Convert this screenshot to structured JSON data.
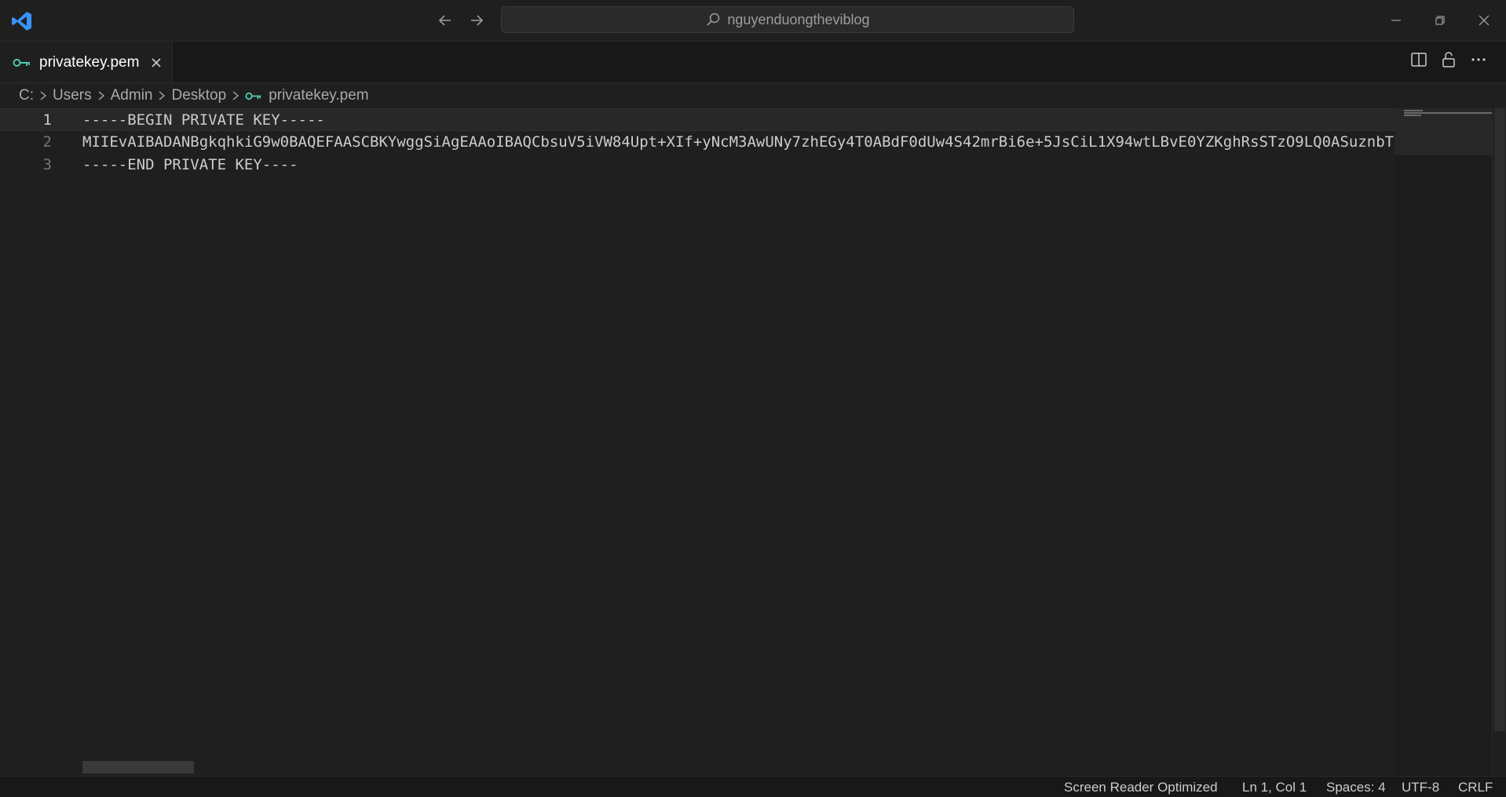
{
  "titlebar": {
    "search_text": "nguyenduongtheviblog"
  },
  "tabs": [
    {
      "label": "privatekey.pem",
      "active": true
    }
  ],
  "breadcrumb": [
    "C:",
    "Users",
    "Admin",
    "Desktop",
    "privatekey.pem"
  ],
  "editor": {
    "lines": [
      {
        "number": "1",
        "text": "-----BEGIN PRIVATE KEY-----"
      },
      {
        "number": "2",
        "text": "MIIEvAIBADANBgkqhkiG9w0BAQEFAASCBKYwggSiAgEAAoIBAQCbsuV5iVW84Upt+XIf+yNcM3AwUNy7zhEGy4T0ABdF0dUw4S42mrBi6e+5JsCiL1X94wtLBvE0YZKghRsSTzO9LQ0ASuznbT"
      },
      {
        "number": "3",
        "text": "-----END PRIVATE KEY----"
      }
    ]
  },
  "statusbar": {
    "screen_reader": "Screen Reader Optimized",
    "position": "Ln 1, Col 1",
    "spaces": "Spaces: 4",
    "encoding": "UTF-8",
    "eol": "CRLF"
  },
  "colors": {
    "accent_blue": "#3794ff",
    "key_icon": "#4ec9b0"
  },
  "icons": [
    "vscode-logo",
    "arrow-left-icon",
    "arrow-right-icon",
    "search-icon",
    "minimize-icon",
    "restore-icon",
    "close-icon",
    "key-icon",
    "split-editor-icon",
    "lock-icon",
    "more-icon",
    "chevron-right-icon"
  ]
}
